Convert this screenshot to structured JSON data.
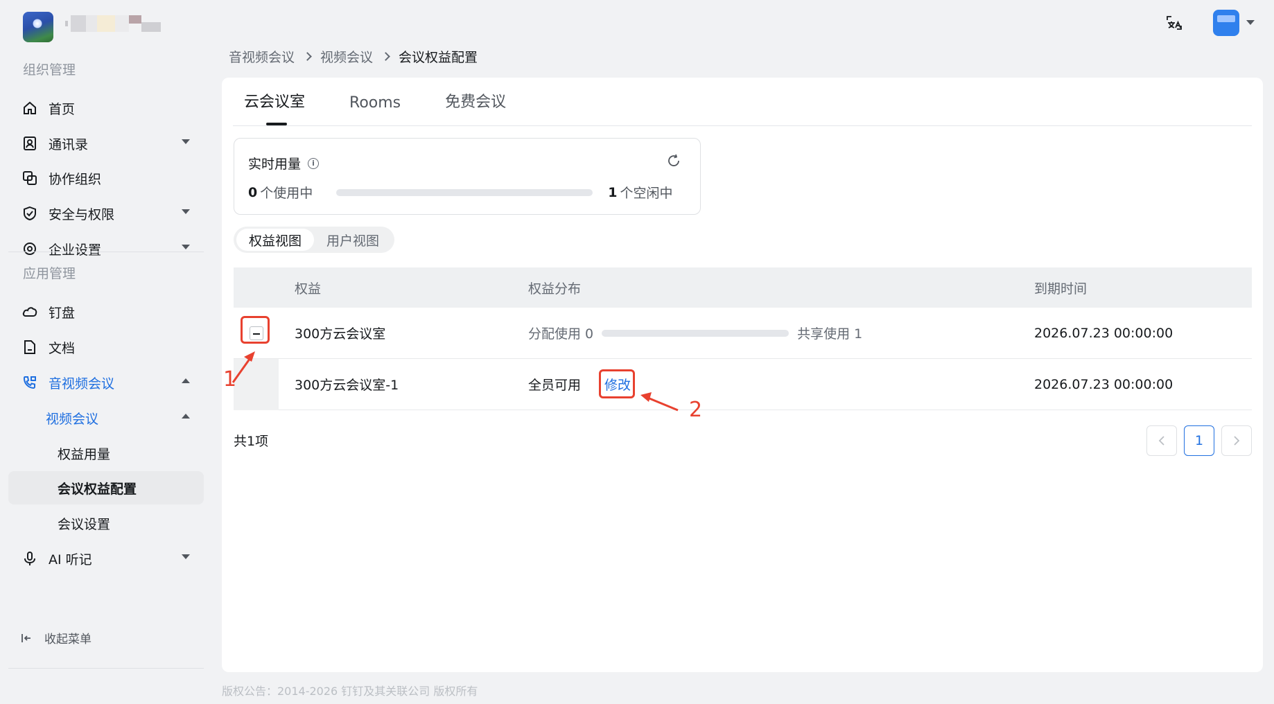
{
  "topbar": {
    "translate_icon": "translate-icon",
    "avatar_caret_icon": "caret-down-icon"
  },
  "sidebar": {
    "section_org": "组织管理",
    "section_apps": "应用管理",
    "items": [
      {
        "label": "首页",
        "icon": "home-icon"
      },
      {
        "label": "通讯录",
        "icon": "contacts-icon"
      },
      {
        "label": "协作组织",
        "icon": "collab-org-icon"
      },
      {
        "label": "安全与权限",
        "icon": "shield-icon"
      },
      {
        "label": "企业设置",
        "icon": "settings-icon"
      },
      {
        "label": "钉盘",
        "icon": "cloud-drive-icon"
      },
      {
        "label": "文档",
        "icon": "document-icon"
      },
      {
        "label": "音视频会议",
        "icon": "phone-video-icon"
      },
      {
        "label": "视频会议"
      },
      {
        "label": "权益用量"
      },
      {
        "label": "会议权益配置"
      },
      {
        "label": "会议设置"
      },
      {
        "label": "AI 听记",
        "icon": "mic-icon"
      }
    ],
    "collapse_label": "收起菜单"
  },
  "breadcrumb": [
    "音视频会议",
    "视频会议",
    "会议权益配置"
  ],
  "tabs": [
    "云会议室",
    "Rooms",
    "免费会议"
  ],
  "usage": {
    "title": "实时用量",
    "in_use_count": "0",
    "in_use_label": "个使用中",
    "idle_count": "1",
    "idle_label": "个空闲中"
  },
  "views": [
    "权益视图",
    "用户视图"
  ],
  "table": {
    "headers": [
      "权益",
      "权益分布",
      "到期时间"
    ],
    "rows": [
      {
        "name": "300方云会议室",
        "alloc_label": "分配使用 0",
        "shared_label": "共享使用 1",
        "expire": "2026.07.23 00:00:00"
      },
      {
        "name": "300方云会议室-1",
        "dist": "全员可用",
        "action": "修改",
        "expire": "2026.07.23 00:00:00"
      }
    ]
  },
  "total": "共1项",
  "pager": {
    "current": "1"
  },
  "annotations": [
    "1",
    "2"
  ],
  "footer": "版权公告：2014-2026 钉钉及其关联公司 版权所有",
  "colors": {
    "accent": "#1f6fe0",
    "annotation": "#e8412f"
  }
}
